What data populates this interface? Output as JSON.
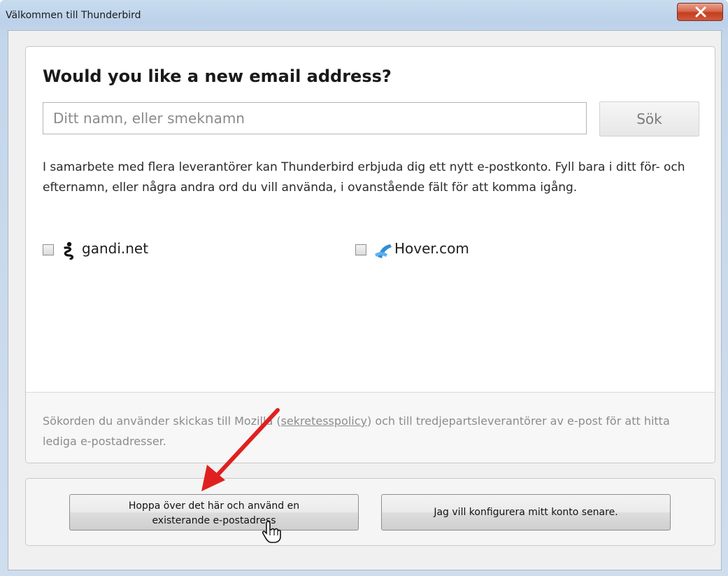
{
  "window": {
    "title": "Välkommen till Thunderbird",
    "close_icon": "close-icon"
  },
  "main": {
    "heading": "Would you like a new email address?",
    "search": {
      "placeholder": "Ditt namn, eller smeknamn",
      "value": "",
      "button_label": "Sök"
    },
    "info_text": "I samarbete med flera leverantörer kan Thunderbird erbjuda dig ett nytt e-postkonto. Fyll bara i ditt för- och efternamn, eller några andra ord du vill använda, i ovanstående fält för att komma igång.",
    "providers": [
      {
        "label": "gandi.net",
        "icon": "gandi-logo-icon",
        "checked": false
      },
      {
        "label": "Hover.com",
        "icon": "hover-logo-icon",
        "checked": false
      }
    ],
    "privacy": {
      "before": "Sökorden du använder skickas till Mozilla (",
      "link": "sekretesspolicy",
      "after": ") och till tredjepartsleverantörer av e-post för att hitta lediga e-postadresser."
    }
  },
  "buttons": {
    "skip_line1": "Hoppa över det här och använd en",
    "skip_line2": "existerande e-postadress",
    "later": "Jag vill konfigurera mitt konto senare."
  },
  "annotation": {
    "arrow_color": "#e02020"
  }
}
